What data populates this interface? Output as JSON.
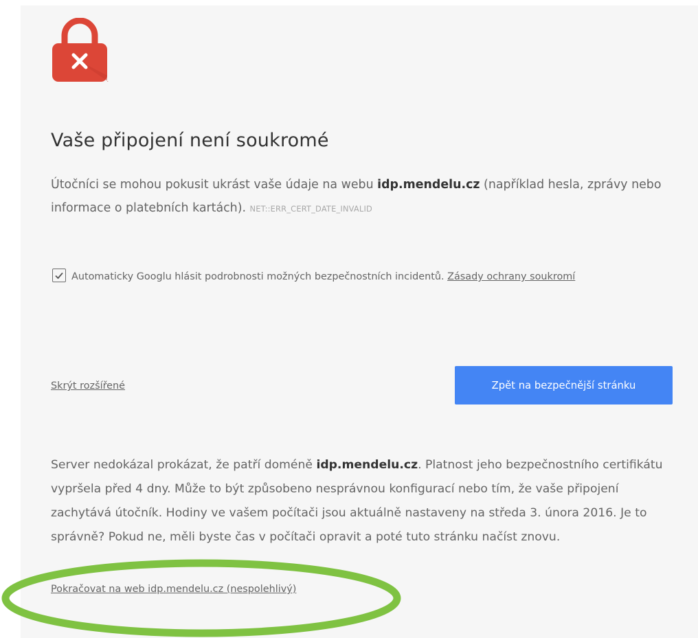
{
  "page": {
    "title": "Vaše připojení není soukromé"
  },
  "icons": {
    "lock": "lock-error-icon",
    "checkmark": "checkmark-icon"
  },
  "colors": {
    "lock_red": "#dc4637",
    "button_blue": "#4485f4",
    "highlight_green": "#7fc242"
  },
  "summary": {
    "before": "Útočníci se mohou pokusit ukrást vaše údaje na webu ",
    "domain": "idp.mendelu.cz",
    "after": " (například hesla, zprávy nebo informace o platebních kartách). ",
    "error_code": "NET::ERR_CERT_DATE_INVALID"
  },
  "reporting": {
    "checked": true,
    "label": "Automaticky Googlu hlásit podrobnosti možných bezpečnostních incidentů. ",
    "privacy_link": "Zásady ochrany soukromí"
  },
  "actions": {
    "hide_advanced": "Skrýt rozšířené",
    "back_button": "Zpět na bezpečnější stránku"
  },
  "details": {
    "before": "Server nedokázal prokázat, že patří doméně ",
    "domain": "idp.mendelu.cz",
    "after": ". Platnost jeho bezpečnostního certifikátu vypršela před 4 dny. Může to být způsobeno nesprávnou konfigurací nebo tím, že vaše připojení zachytává útočník. Hodiny ve vašem počítači jsou aktuálně nastaveny na středa 3. února 2016. Je to správně? Pokud ne, měli byste čas v počítači opravit a poté tuto stránku načíst znovu."
  },
  "proceed": {
    "link": "Pokračovat na web idp.mendelu.cz (nespolehlivý)"
  }
}
